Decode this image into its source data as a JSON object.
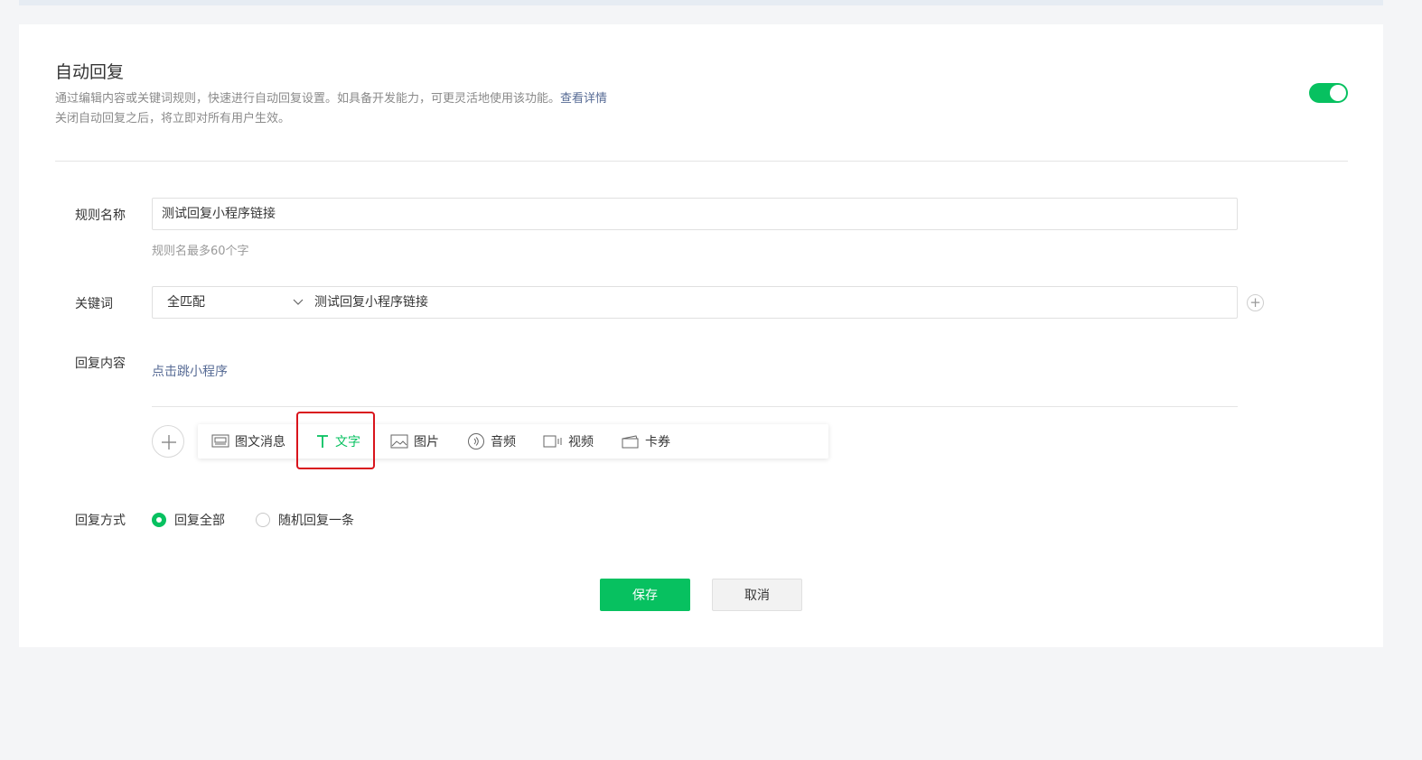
{
  "header": {
    "title": "自动回复",
    "desc_line1": "通过编辑内容或关键词规则，快速进行自动回复设置。如具备开发能力，可更灵活地使用该功能。",
    "details_link": "查看详情",
    "desc_line2": "关闭自动回复之后，将立即对所有用户生效。",
    "toggle_on": true
  },
  "form": {
    "rule_name_label": "规则名称",
    "rule_name_value": "测试回复小程序链接",
    "rule_name_hint": "规则名最多60个字",
    "keyword_label": "关键词",
    "keyword_match": "全匹配",
    "keyword_value": "测试回复小程序链接",
    "keyword_add": "+",
    "reply_content_label": "回复内容",
    "reply_content_item": "点击跳小程序",
    "media_types": [
      {
        "label": "图文消息",
        "icon": "news-icon"
      },
      {
        "label": "文字",
        "icon": "text-icon",
        "active": true
      },
      {
        "label": "图片",
        "icon": "image-icon"
      },
      {
        "label": "音频",
        "icon": "audio-icon"
      },
      {
        "label": "视频",
        "icon": "video-icon"
      },
      {
        "label": "卡券",
        "icon": "card-icon"
      }
    ],
    "reply_mode_label": "回复方式",
    "reply_modes": [
      {
        "label": "回复全部",
        "checked": true
      },
      {
        "label": "随机回复一条",
        "checked": false
      }
    ]
  },
  "actions": {
    "save_label": "保存",
    "cancel_label": "取消"
  },
  "colors": {
    "accent": "#07c160",
    "link": "#576b95",
    "highlight": "#d9141c"
  }
}
